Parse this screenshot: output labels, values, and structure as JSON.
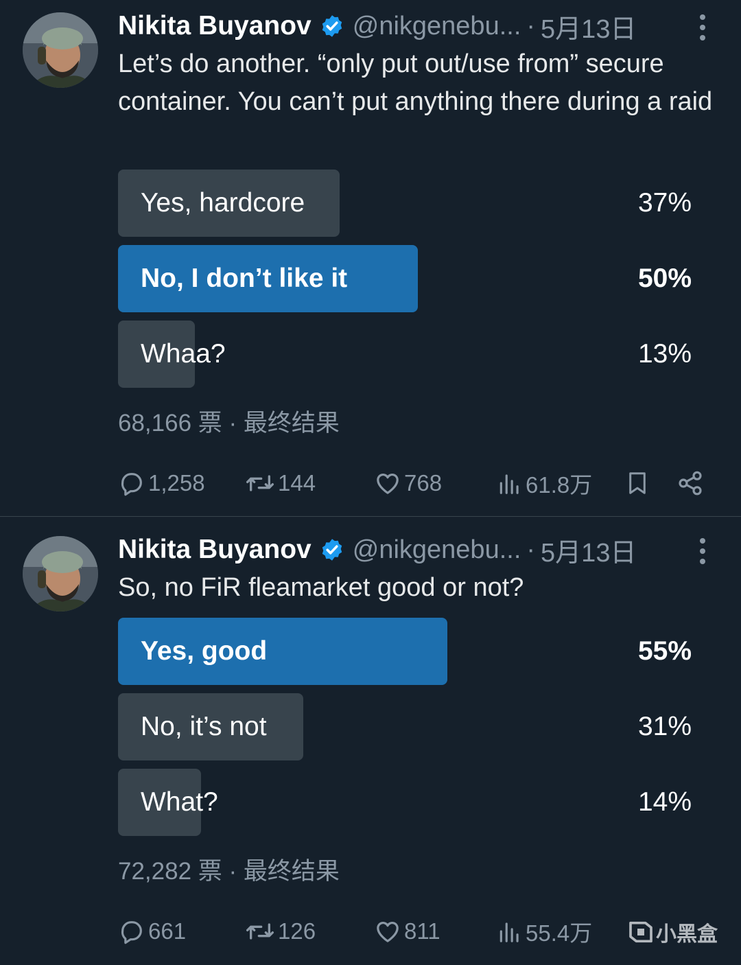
{
  "tweets": [
    {
      "author": {
        "name": "Nikita Buyanov",
        "handle": "@nikgenebu...",
        "date": "5月13日"
      },
      "text": "Let’s do another. “only put out/use from” secure container. You can’t put anything there during a raid",
      "poll": {
        "options": [
          {
            "label": "Yes, hardcore",
            "percent": "37%",
            "share": 0.37,
            "winner": false
          },
          {
            "label": "No, I don’t like it",
            "percent": "50%",
            "share": 0.5,
            "winner": true
          },
          {
            "label": "Whaa?",
            "percent": "13%",
            "share": 0.13,
            "winner": false
          }
        ],
        "votes": "68,166 票",
        "status": "最终结果"
      },
      "actions": {
        "replies": "1,258",
        "retweets": "144",
        "likes": "768",
        "views": "61.8万"
      }
    },
    {
      "author": {
        "name": "Nikita Buyanov",
        "handle": "@nikgenebu...",
        "date": "5月13日"
      },
      "text": "So, no FiR fleamarket good or not?",
      "poll": {
        "options": [
          {
            "label": "Yes, good",
            "percent": "55%",
            "share": 0.55,
            "winner": true
          },
          {
            "label": "No, it’s not",
            "percent": "31%",
            "share": 0.31,
            "winner": false
          },
          {
            "label": "What?",
            "percent": "14%",
            "share": 0.14,
            "winner": false
          }
        ],
        "votes": "72,282 票",
        "status": "最终结果"
      },
      "actions": {
        "replies": "661",
        "retweets": "126",
        "likes": "811",
        "views": "55.4万"
      }
    }
  ],
  "watermark": "小黑盒",
  "colors": {
    "background": "#15202b",
    "winner_bar": "#1d6fae",
    "loser_bar": "#38444d",
    "muted_text": "#8b98a5",
    "verified": "#1d9bf0"
  },
  "icons": [
    "avatar-photo",
    "verified-badge-icon",
    "more-icon",
    "reply-icon",
    "retweet-icon",
    "like-icon",
    "views-icon",
    "bookmark-icon",
    "share-icon"
  ]
}
